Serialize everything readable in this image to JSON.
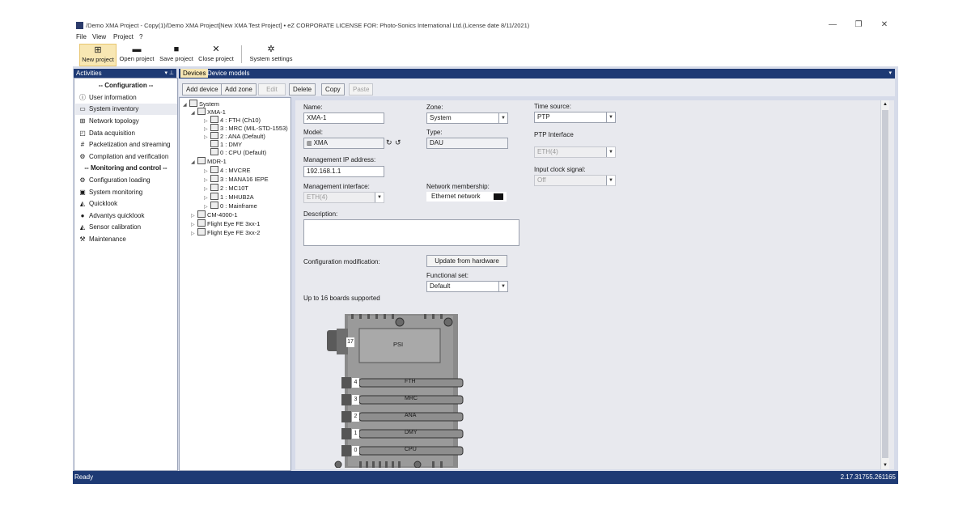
{
  "window": {
    "title": "/Demo XMA Project - Copy(1)/Demo XMA Project[New XMA Test Project] • eZ    CORPORATE LICENSE FOR: Photo-Sonics International Ltd.(License date 8/11/2021)",
    "minimize": "—",
    "restore": "❐",
    "close": "✕"
  },
  "menu": {
    "file": "File",
    "view": "View",
    "project": "Project",
    "help": "?"
  },
  "toolbar": {
    "new_project": "New project",
    "open_project": "Open project",
    "save_project": "Save project",
    "close_project": "Close project",
    "system_settings": "System settings"
  },
  "activities": {
    "header": "Activities",
    "pin": "▾ ⊥",
    "config_header": "-- Configuration --",
    "monitor_header": "-- Monitoring and control --",
    "items": [
      {
        "label": "User information",
        "icon": "info-icon"
      },
      {
        "label": "System inventory",
        "icon": "inventory-icon"
      },
      {
        "label": "Network topology",
        "icon": "network-icon"
      },
      {
        "label": "Data acquisition",
        "icon": "acquisition-icon"
      },
      {
        "label": "Packetization and streaming",
        "icon": "packet-icon"
      },
      {
        "label": "Compilation and verification",
        "icon": "compile-icon"
      },
      {
        "label": "Configuration loading",
        "icon": "load-icon"
      },
      {
        "label": "System monitoring",
        "icon": "monitor-icon"
      },
      {
        "label": "Quicklook",
        "icon": "quicklook-icon"
      },
      {
        "label": "Advantys quicklook",
        "icon": "advantys-icon"
      },
      {
        "label": "Sensor calibration",
        "icon": "calibration-icon"
      },
      {
        "label": "Maintenance",
        "icon": "wrench-icon"
      }
    ]
  },
  "tabs": {
    "devices": "Devices",
    "device_models": "Device models",
    "menu": "▾"
  },
  "device_toolbar": {
    "add_device": "Add device",
    "add_zone": "Add zone",
    "edit": "Edit",
    "delete": "Delete",
    "copy": "Copy",
    "paste": "Paste"
  },
  "tree": {
    "system": "System",
    "xma": "XMA-1",
    "xma_children": [
      "4 : FTH (Ch10)",
      "3 : MRC (MIL-STD-1553)",
      "2 : ANA (Default)",
      "1 : DMY",
      "0 : CPU (Default)"
    ],
    "mdr": "MDR-1",
    "mdr_children": [
      "4 : MVCRE",
      "3 : MANA16 IEPE",
      "2 : MC10T",
      "1 : MHUB2A",
      "0 : Mainframe"
    ],
    "others": [
      "CM-4000-1",
      "Flight Eye FE 3xx-1",
      "Flight Eye FE 3xx-2"
    ]
  },
  "props": {
    "name_label": "Name:",
    "name_value": "XMA-1",
    "zone_label": "Zone:",
    "zone_value": "System",
    "time_source_label": "Time source:",
    "time_source_value": "PTP",
    "model_label": "Model:",
    "model_value": "XMA",
    "type_label": "Type:",
    "type_value": "DAU",
    "ptp_interface_label": "PTP Interface",
    "ptp_interface_value": "ETH(4)",
    "mgmt_ip_label": "Management IP address:",
    "mgmt_ip_value": "192.168.1.1",
    "input_clock_label": "Input clock signal:",
    "input_clock_value": "Off",
    "mgmt_iface_label": "Management interface:",
    "mgmt_iface_value": "ETH(4)",
    "network_label": "Network membership:",
    "network_value": "Ethernet network",
    "network_color": "#111111",
    "description_label": "Description:",
    "description_value": "",
    "config_mod_label": "Configuration modification:",
    "update_button": "Update from hardware",
    "functional_set_label": "Functional set:",
    "functional_set_value": "Default",
    "boards_note": "Up to 16 boards supported"
  },
  "board": {
    "psi_slot": "17",
    "psi_label": "PSI",
    "slots": [
      {
        "num": "4",
        "name": "FTH"
      },
      {
        "num": "3",
        "name": "MRC"
      },
      {
        "num": "2",
        "name": "ANA"
      },
      {
        "num": "1",
        "name": "DMY"
      },
      {
        "num": "0",
        "name": "CPU"
      }
    ]
  },
  "status": {
    "left": "Ready",
    "right": "2.17.31755.261165"
  },
  "colors": {
    "accent": "#1e3a74",
    "selected_tab": "#f8e7b3",
    "app_bg": "#d6dbe9"
  }
}
